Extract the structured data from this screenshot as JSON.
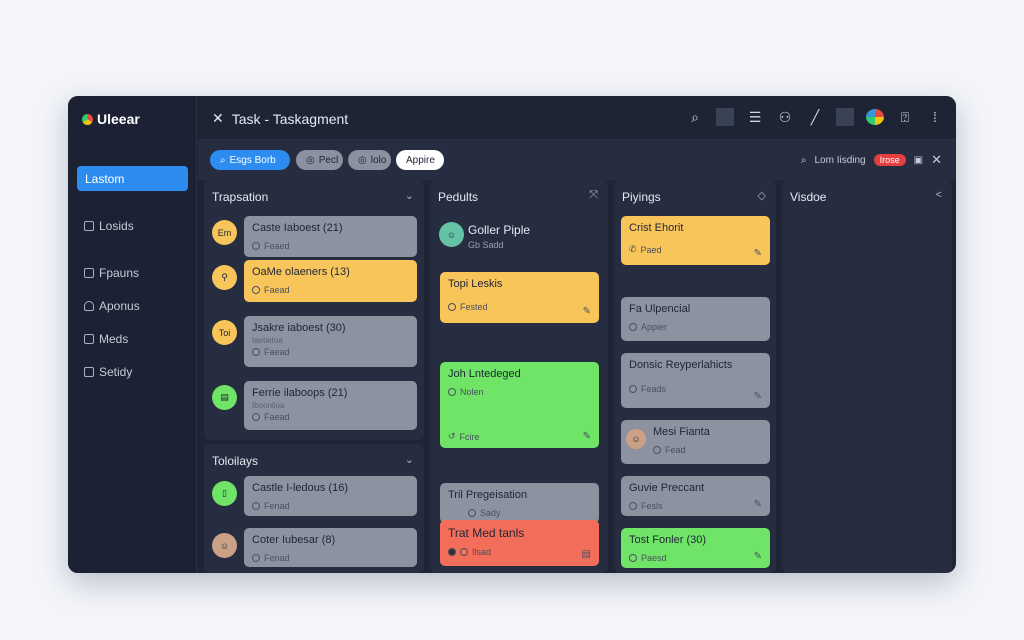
{
  "app": {
    "name": "Uleear"
  },
  "sidebar": {
    "active": "Lastom",
    "items": [
      {
        "label": "Losids"
      },
      {
        "label": "Fpauns"
      },
      {
        "label": "Aponus"
      },
      {
        "label": "Meds"
      },
      {
        "label": "Setidy"
      }
    ]
  },
  "topbar": {
    "title": "Task - Taskagment"
  },
  "filters": {
    "chips": [
      {
        "label": "Esgs Borb"
      },
      {
        "label": "Pecl"
      },
      {
        "label": "lolo"
      },
      {
        "label": "Appire"
      }
    ],
    "search_label": "Lom Iisding",
    "badge": "Irose"
  },
  "columns": {
    "c1": {
      "title": "Trapsation",
      "cards": [
        {
          "bullet": "Em",
          "title": "Caste Iaboest (21)",
          "sub": "Feaed"
        },
        {
          "bullet": "",
          "title": "OaMe olaeners (13)",
          "sub": "Faead"
        },
        {
          "bullet": "Toi",
          "title": "Jsakre iaboest (30)",
          "sub2": "Iaetietoa",
          "sub": "Faead"
        },
        {
          "bullet": "",
          "title": "Ferrie ilaboops (21)",
          "sub2": "Iboonlioa",
          "sub": "Faead"
        }
      ]
    },
    "c1b": {
      "title": "Toloilays",
      "cards": [
        {
          "title": "Castle I-ledous (16)",
          "sub": "Fenad"
        },
        {
          "title": "Coter Iubesar (8)",
          "sub": "Fenad"
        }
      ]
    },
    "c2": {
      "title": "Pedults",
      "profile": {
        "name": "Goller Piple",
        "sub": "Gb Sadd"
      },
      "cards": [
        {
          "title": "Topi Leskis",
          "sub": "Fested"
        },
        {
          "title": "Joh Lntedeged",
          "sub": "Nolen",
          "foot": "Fcire"
        },
        {
          "title": "Tril Pregeisation",
          "sub": "Sady"
        },
        {
          "title": "Trat Med tanls",
          "sub": "Ilsad"
        }
      ]
    },
    "c3": {
      "title": "Piyings",
      "cards": [
        {
          "title": "Crist Ehorit",
          "sub": "Paed"
        },
        {
          "title": "Fa Ulpencial",
          "sub": "Appier"
        },
        {
          "title": "Donsic Reyperlahicts",
          "sub": "Feads"
        },
        {
          "title": "Mesi Fianta",
          "sub": "Fead"
        },
        {
          "title": "Guvie Preccant",
          "sub": "Fesls"
        },
        {
          "title": "Tost Fonler (30)",
          "sub": "Paesd"
        }
      ]
    },
    "c4": {
      "title": "Visdoe"
    }
  },
  "colors": {
    "accent": "#2d8cf0",
    "grey_card": "#8c929f",
    "yellow_card": "#f8c55b",
    "green_card": "#6fe466",
    "red_card": "#f26e5b",
    "panel": "#262d40"
  }
}
